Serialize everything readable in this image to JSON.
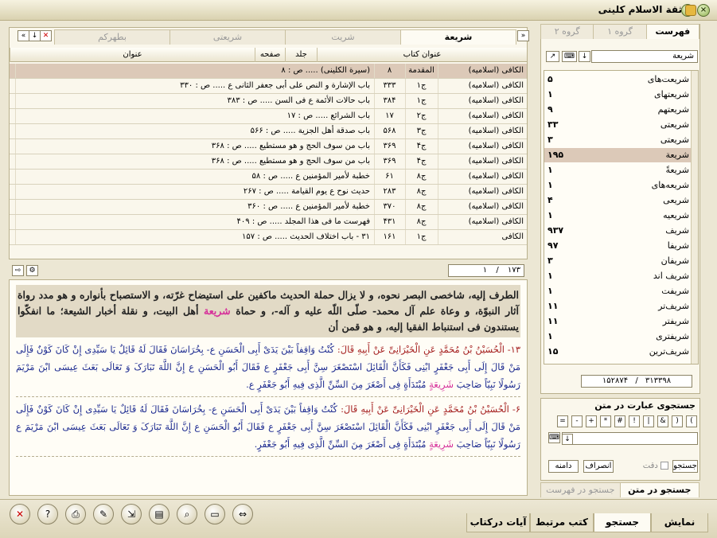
{
  "window": {
    "title": "ثقة الاسلام كلینی"
  },
  "top_tabs": [
    "بطهرکم",
    "شریعتی",
    "شریت",
    "شریعة"
  ],
  "grid": {
    "headers": {
      "title": "عنوان",
      "page": "صفحه",
      "volume": "جلد",
      "book": "عنوان کتاب"
    },
    "rows": [
      {
        "book": "الکافی (اسلامیه)",
        "volume": "المقدمة",
        "page": "۸",
        "title": "(سیرة الکلینی) ..... ص : ۸"
      },
      {
        "book": "الکافی (اسلامیه)",
        "volume": "ج‌۱",
        "page": "۳۳۳",
        "title": "باب الإشارة و النص علی أبی جعفر الثانی ع ..... ص : ۳۳۰"
      },
      {
        "book": "الکافی (اسلامیه)",
        "volume": "ج‌۱",
        "page": "۳۸۴",
        "title": "باب حالات الأئمة ع فی السن ..... ص : ۳۸۳"
      },
      {
        "book": "الکافی (اسلامیه)",
        "volume": "ج‌۲",
        "page": "۱۷",
        "title": "باب الشرائع ..... ص : ۱۷"
      },
      {
        "book": "الکافی (اسلامیه)",
        "volume": "ج‌۳",
        "page": "۵۶۸",
        "title": "باب صدقة أهل الجزیة ..... ص : ۵۶۶"
      },
      {
        "book": "الکافی (اسلامیه)",
        "volume": "ج‌۴",
        "page": "۳۶۹",
        "title": "باب من سوف الحج و هو مستطیع ..... ص : ۳۶۸"
      },
      {
        "book": "الکافی (اسلامیه)",
        "volume": "ج‌۴",
        "page": "۳۶۹",
        "title": "باب من سوف الحج و هو مستطیع ..... ص : ۳۶۸"
      },
      {
        "book": "الکافی (اسلامیه)",
        "volume": "ج‌۸",
        "page": "۶۱",
        "title": "خطبة لأمیر المؤمنین ع ..... ص : ۵۸"
      },
      {
        "book": "الکافی (اسلامیه)",
        "volume": "ج‌۸",
        "page": "۲۸۳",
        "title": "حدیث نوح ع یوم القیامة ..... ص : ۲۶۷"
      },
      {
        "book": "الکافی (اسلامیه)",
        "volume": "ج‌۸",
        "page": "۳۷۰",
        "title": "خطبة لأمیر المؤمنین ع ..... ص : ۳۶۰"
      },
      {
        "book": "الکافی (اسلامیه)",
        "volume": "ج‌۸",
        "page": "۴۳۱",
        "title": "فهرست ما فی هذا المجلد ..... ص : ۴۰۹"
      },
      {
        "book": "الکافی",
        "volume": "ج‌۱",
        "page": "۱۶۱",
        "title": "۳۱ - باب اختلاف الحدیث ..... ص : ۱۵۷"
      }
    ]
  },
  "pager": {
    "current": "۱",
    "total": "۱۷۳"
  },
  "reader": {
    "intro": "الطرف إلیه، شاخصی البصر نحوه، و لا یزال حملة الحدیث ماکفین علی استیضاح غرّته، و الاستصباح بأنواره و هو مدد رواة آثار النبوّة، و وعاة علم آل محمد- صلّی اللّه علیه و آله-، و حماة",
    "intro_kw": "شریعة",
    "intro_end": "أهل البیت، و نقلة أخبار الشیعة؛ ما انفکّوا یستندون فی استنباط الفقیا إلیه، و هو قمن أن",
    "h1_sanad": "۱۳- الْحُسَیْنُ بْنُ مُحَمَّدٍ عَنِ الْخَیْرَانِیِّ عَنْ أَبِیهِ قَالَ:",
    "h1_matn": "کُنْتُ وَاقِفاً بَیْنَ یَدَیْ أَبِی الْحَسَنِ ع- بِخُرَاسَانَ فَقَالَ لَهُ قَائِلٌ یَا سَیِّدِی إِنْ کَانَ کَوْنٌ فَإِلَی مَنْ قَالَ إِلَی أَبِی جَعْفَرٍ ابْنِی فَکَأَنَّ الْقَائِلَ اسْتَصْغَرَ سِنَّ أَبِی جَعْفَرٍ ع فَقَالَ أَبُو الْحَسَنِ ع إِنَّ اللَّهَ تَبَارَکَ وَ تَعَالَی بَعَثَ عِیسَی ابْنَ مَرْیَمَ رَسُولًا نَبِیّاً صَاحِبَ",
    "h1_kw": "شَرِیعَةٍ",
    "h1_end": "مُبْتَدَأَةٍ فِی أَصْغَرَ مِنَ السِّنِّ الَّذِی فِیهِ أَبُو جَعْفَرٍ ع.",
    "h2_sanad": "۶- الْحُسَیْنُ بْنُ مُحَمَّدٍ عَنِ الْخَیْرَانِیِّ عَنْ أَبِیهِ قَالَ:",
    "h2_matn": "کُنْتُ وَاقِفاً بَیْنَ یَدَیْ أَبِی الْحَسَنِ ع- بِخُرَاسَانَ فَقَالَ لَهُ قَائِلٌ یَا سَیِّدِی إِنْ کَانَ کَوْنٌ فَإِلَی مَنْ قَالَ إِلَی أَبِی جَعْفَرٍ ابْنِی فَکَأَنَّ الْقَائِلَ اسْتَصْغَرَ سِنَّ أَبِی جَعْفَرٍ ع فَقَالَ أَبُو الْحَسَنِ ع إِنَّ اللَّهَ تَبَارَکَ وَ تَعَالَی بَعَثَ عِیسَی ابْنَ مَرْیَمَ ع رَسُولًا نَبِیّاً صَاحِبَ",
    "h2_kw": "شَرِیعَةٍ",
    "h2_end": "مُبْتَدَأَةٍ فِی أَصْغَرَ مِنَ السِّنِّ الَّذِی فِیهِ أَبُو جَعْفَرٍ."
  },
  "right_tabs": [
    "فهرست",
    "گروه ۱",
    "گروه ۲"
  ],
  "search_value": "شریعة",
  "word_list": [
    {
      "label": "شریعت‌های",
      "count": "۵"
    },
    {
      "label": "شریعتهای",
      "count": "۱"
    },
    {
      "label": "شریعتهم",
      "count": "۹"
    },
    {
      "label": "شریعتی",
      "count": "۳۳"
    },
    {
      "label": "شریعتی",
      "count": "۳"
    },
    {
      "label": "شریعة",
      "count": "۱۹۵"
    },
    {
      "label": "شریعةً",
      "count": "۱"
    },
    {
      "label": "شریعه‌های",
      "count": "۱"
    },
    {
      "label": "شریعی",
      "count": "۴"
    },
    {
      "label": "شریعیه",
      "count": "۱"
    },
    {
      "label": "شریف",
      "count": "۹۳۷"
    },
    {
      "label": "شریفا",
      "count": "۹۷"
    },
    {
      "label": "شریفان",
      "count": "۳"
    },
    {
      "label": "شریف اند",
      "count": "۱"
    },
    {
      "label": "شریفت",
      "count": "۱"
    },
    {
      "label": "شریف‌تر",
      "count": "۱۱"
    },
    {
      "label": "شریفتر",
      "count": "۱۱"
    },
    {
      "label": "شریفتری",
      "count": "۱"
    },
    {
      "label": "شریف‌ترین",
      "count": "۱۵"
    }
  ],
  "list_counts": {
    "a": "۳۱۳۳۹۸",
    "b": "۱۵۲۸۷۴"
  },
  "text_search": {
    "title": "جستجوی عبارت در متن",
    "keys": [
      "(",
      ")",
      "&",
      "|",
      "!",
      "#",
      "*",
      "+",
      "-",
      "="
    ],
    "search_btn": "جستجو",
    "exact_label": "دقت",
    "operator_btn": "انصراف",
    "scope_btn": "دامنه"
  },
  "right_bottom_tabs": [
    "جستجو در متن",
    "جستجو در فهرست"
  ],
  "bottom_tabs": [
    "نمایش",
    "جستجو",
    "کتب مرتبط",
    "آیات درکتاب"
  ],
  "toolbar_icons": [
    "close-icon",
    "help-icon",
    "print-icon",
    "edit-icon",
    "export-icon",
    "note-icon",
    "find-icon",
    "bookmark-icon",
    "split-icon"
  ]
}
